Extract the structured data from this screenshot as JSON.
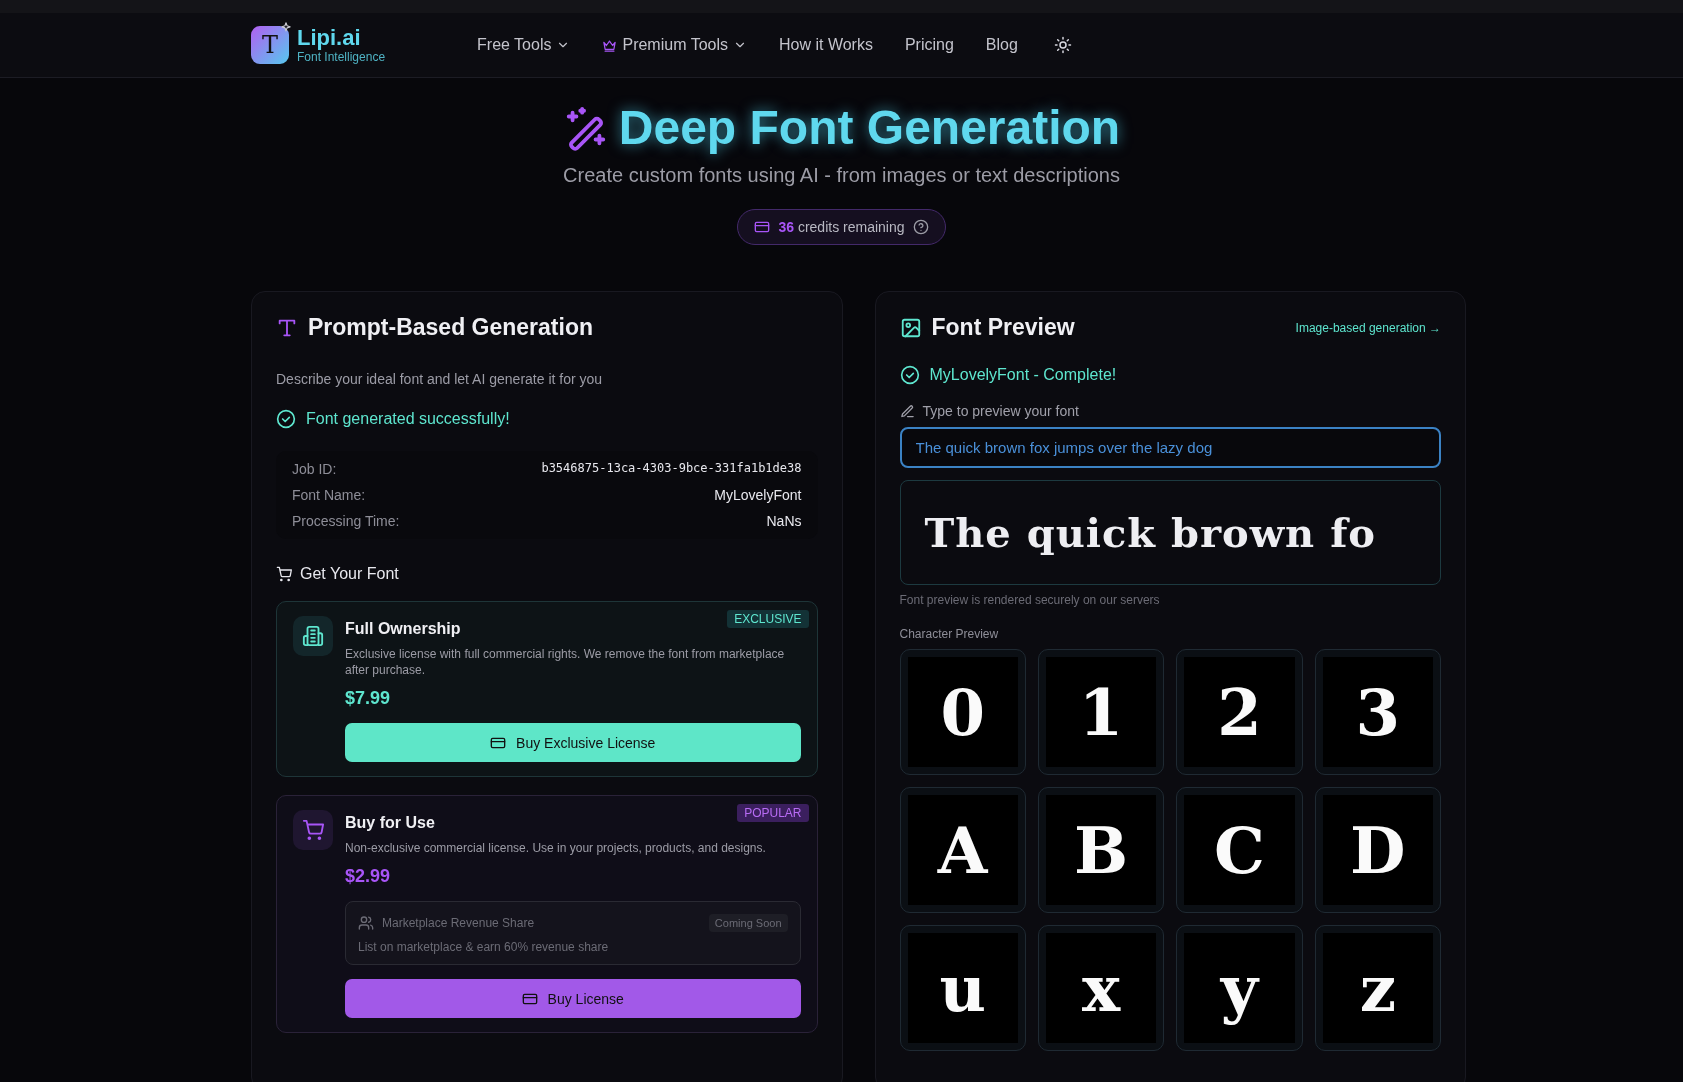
{
  "header": {
    "logo": {
      "mark": "T",
      "name": "Lipi.ai",
      "tagline": "Font Intelligence"
    },
    "nav": [
      {
        "label": "Free Tools",
        "kind": "dropdown"
      },
      {
        "label": "Premium Tools",
        "kind": "premium-dropdown"
      },
      {
        "label": "How it Works",
        "kind": "link"
      },
      {
        "label": "Pricing",
        "kind": "link"
      },
      {
        "label": "Blog",
        "kind": "link"
      }
    ]
  },
  "hero": {
    "title": "Deep Font Generation",
    "subtitle": "Create custom fonts using AI - from images or text descriptions",
    "credits": {
      "count": "36",
      "label": "credits remaining"
    }
  },
  "prompt_panel": {
    "title": "Prompt-Based Generation",
    "description": "Describe your ideal font and let AI generate it for you",
    "status": "Font generated successfully!",
    "details": [
      {
        "label": "Job ID:",
        "value": "b3546875-13ca-4303-9bce-331fa1b1de38",
        "kind": "mono"
      },
      {
        "label": "Font Name:",
        "value": "MyLovelyFont",
        "kind": "text"
      },
      {
        "label": "Processing Time:",
        "value": "NaNs",
        "kind": "text"
      }
    ],
    "purchase_heading": "Get Your Font",
    "options": [
      {
        "kind": "exclusive",
        "title": "Full Ownership",
        "badge": "EXCLUSIVE",
        "description": "Exclusive license with full commercial rights. We remove the font from marketplace after purchase.",
        "price": "$7.99",
        "button": "Buy Exclusive License"
      },
      {
        "kind": "popular",
        "title": "Buy for Use",
        "badge": "POPULAR",
        "description": "Non-exclusive commercial license. Use in your projects, products, and designs.",
        "price": "$2.99",
        "addon": {
          "title": "Marketplace Revenue Share",
          "badge": "Coming Soon",
          "description": "List on marketplace & earn 60% revenue share",
          "disabled": true
        },
        "button": "Buy License"
      }
    ]
  },
  "preview_panel": {
    "title": "Font Preview",
    "link": "Image-based generation →",
    "status": "MyLovelyFont - Complete!",
    "input": {
      "label": "Type to preview your font",
      "value": "The quick brown fox jumps over the lazy dog",
      "focused": true
    },
    "rendered_text": "The quick brown fo",
    "note": "Font preview is rendered securely on our servers",
    "characters_label": "Character Preview",
    "characters": [
      "0",
      "1",
      "2",
      "3",
      "A",
      "B",
      "C",
      "D",
      "u",
      "x",
      "y",
      "z"
    ]
  }
}
